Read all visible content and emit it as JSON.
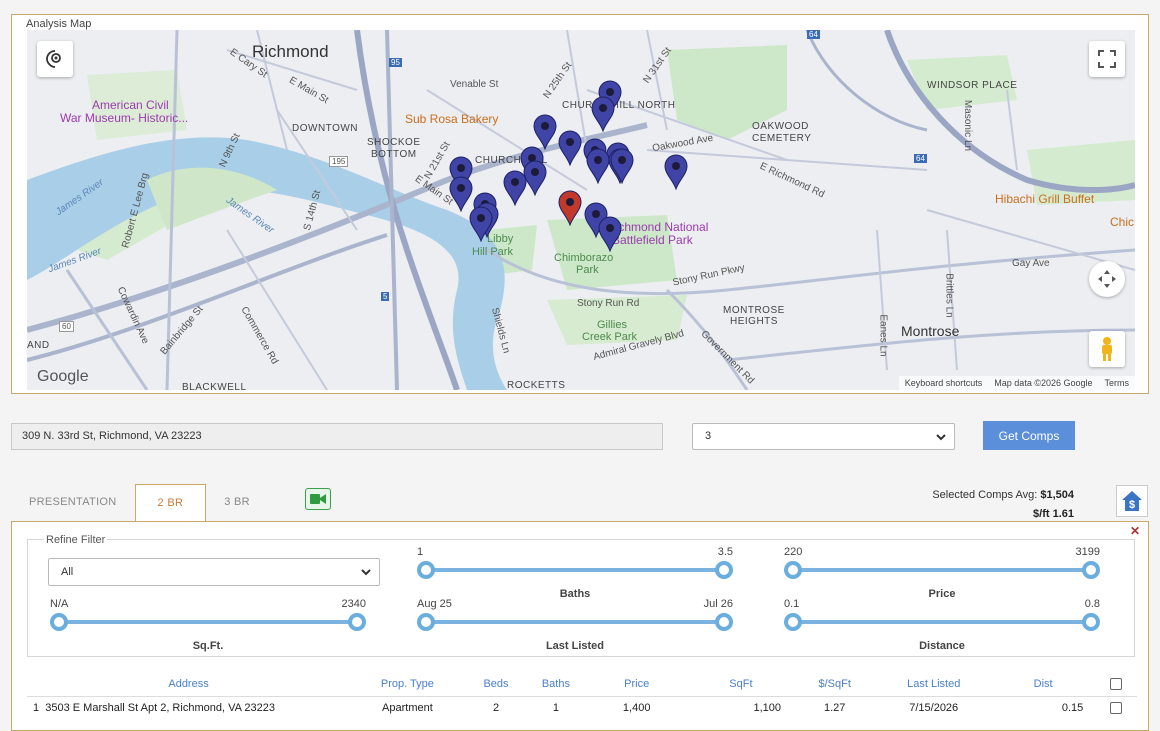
{
  "map_panel": {
    "title": "Analysis Map",
    "labels": {
      "richmond": "Richmond",
      "downtown": "DOWNTOWN",
      "shockoe": "SHOCKOE",
      "bottom": "BOTTOM",
      "church_hill": "CHURCH HILL",
      "church_hill_north": "CHURCH HILL NORTH",
      "windsor_place": "WINDSOR PLACE",
      "oakwood": "OAKWOOD",
      "cemetery": "CEMETERY",
      "montrose_heights": "MONTROSE",
      "heights": "HEIGHTS",
      "montrose": "Montrose",
      "blackwell": "BLACKWELL",
      "rocketts": "ROCKETTS",
      "and": "AND",
      "civil_war_1": "American Civil",
      "civil_war_2": "War Museum- Historic...",
      "sub_rosa": "Sub Rosa Bakery",
      "hibachi": "Hibachi Grill Buffet",
      "chic": "Chic",
      "battlefield_1": "Richmond National",
      "battlefield_2": "Battlefield Park",
      "chimborazo_1": "Chimborazo",
      "chimborazo_2": "Park",
      "libby_1": "Libby",
      "libby_2": "Hill Park",
      "gillies_1": "Gillies",
      "gillies_2": "Creek Park",
      "james_river_1": "James River",
      "james_river_2": "James River",
      "james_river_3": "James River",
      "venable": "Venable St",
      "oakwood_ave": "Oakwood Ave",
      "e_richmond_rd": "E Richmond Rd",
      "stony_run_rd": "Stony Run Rd",
      "stony_run_pkwy": "Stony Run Pkwy",
      "admiral_gravely": "Admiral Gravely Blvd",
      "government_rd": "Government Rd",
      "gay_ave": "Gay Ave",
      "e_main": "E Main St",
      "e_cary": "E Cary St",
      "e_main2": "E Main St",
      "n_21st": "N 21st St",
      "n_25th": "N 25th St",
      "n_31st": "N 31st St",
      "n_9th": "N 9th St",
      "s_14th": "S 14th St",
      "cowardin": "Cowardin Ave",
      "bainbridge": "Bainbridge St",
      "commerce": "Commerce Rd",
      "robert_e_lee": "Robert E Lee Brg",
      "masonic": "Masonic Ln",
      "brittles": "Brittles Ln",
      "eanes": "Eanes Ln",
      "shields": "Shields Ln",
      "hwy_195": "195",
      "hwy_64": "64",
      "hwy_95": "95",
      "hwy_60": "60",
      "hwy_5": "5",
      "hwy_64b": "64"
    },
    "google_logo": "Google",
    "attribution": {
      "shortcuts": "Keyboard shortcuts",
      "data": "Map data ©2026 Google",
      "terms": "Terms"
    },
    "pin_color": "#3f44a6",
    "subject_pin_color": "#c0392b"
  },
  "search": {
    "address": "309 N. 33rd St, Richmond, VA 23223",
    "comp_count": "3",
    "button_label": "Get Comps"
  },
  "tabs": [
    "PRESENTATION",
    "2 BR",
    "3 BR"
  ],
  "summary": {
    "avg_label": "Selected Comps Avg:",
    "avg_value": "$1,504",
    "sqft_label": "$/ft",
    "sqft_value": "1.61"
  },
  "filter": {
    "title": "Refine Filter",
    "select_value": "All",
    "sliders": {
      "baths": {
        "min": "1",
        "max": "3.5",
        "label": "Baths"
      },
      "price": {
        "min": "220",
        "max": "3199",
        "label": "Price"
      },
      "sqft": {
        "min": "N/A",
        "max": "2340",
        "label": "Sq.Ft."
      },
      "listed": {
        "min": "Aug 25",
        "max": "Jul 26",
        "label": "Last Listed"
      },
      "distance": {
        "min": "0.1",
        "max": "0.8",
        "label": "Distance"
      }
    }
  },
  "table": {
    "headers": [
      "Address",
      "Prop. Type",
      "Beds",
      "Baths",
      "Price",
      "SqFt",
      "$/SqFt",
      "Last Listed",
      "Dist"
    ],
    "rows": [
      {
        "num": "1",
        "address": "3503 E Marshall St Apt 2, Richmond, VA 23223",
        "type": "Apartment",
        "beds": "2",
        "baths": "1",
        "price": "1,400",
        "sqft": "1,100",
        "ppsf": "1.27",
        "listed": "7/15/2026",
        "dist": "0.15"
      }
    ]
  }
}
